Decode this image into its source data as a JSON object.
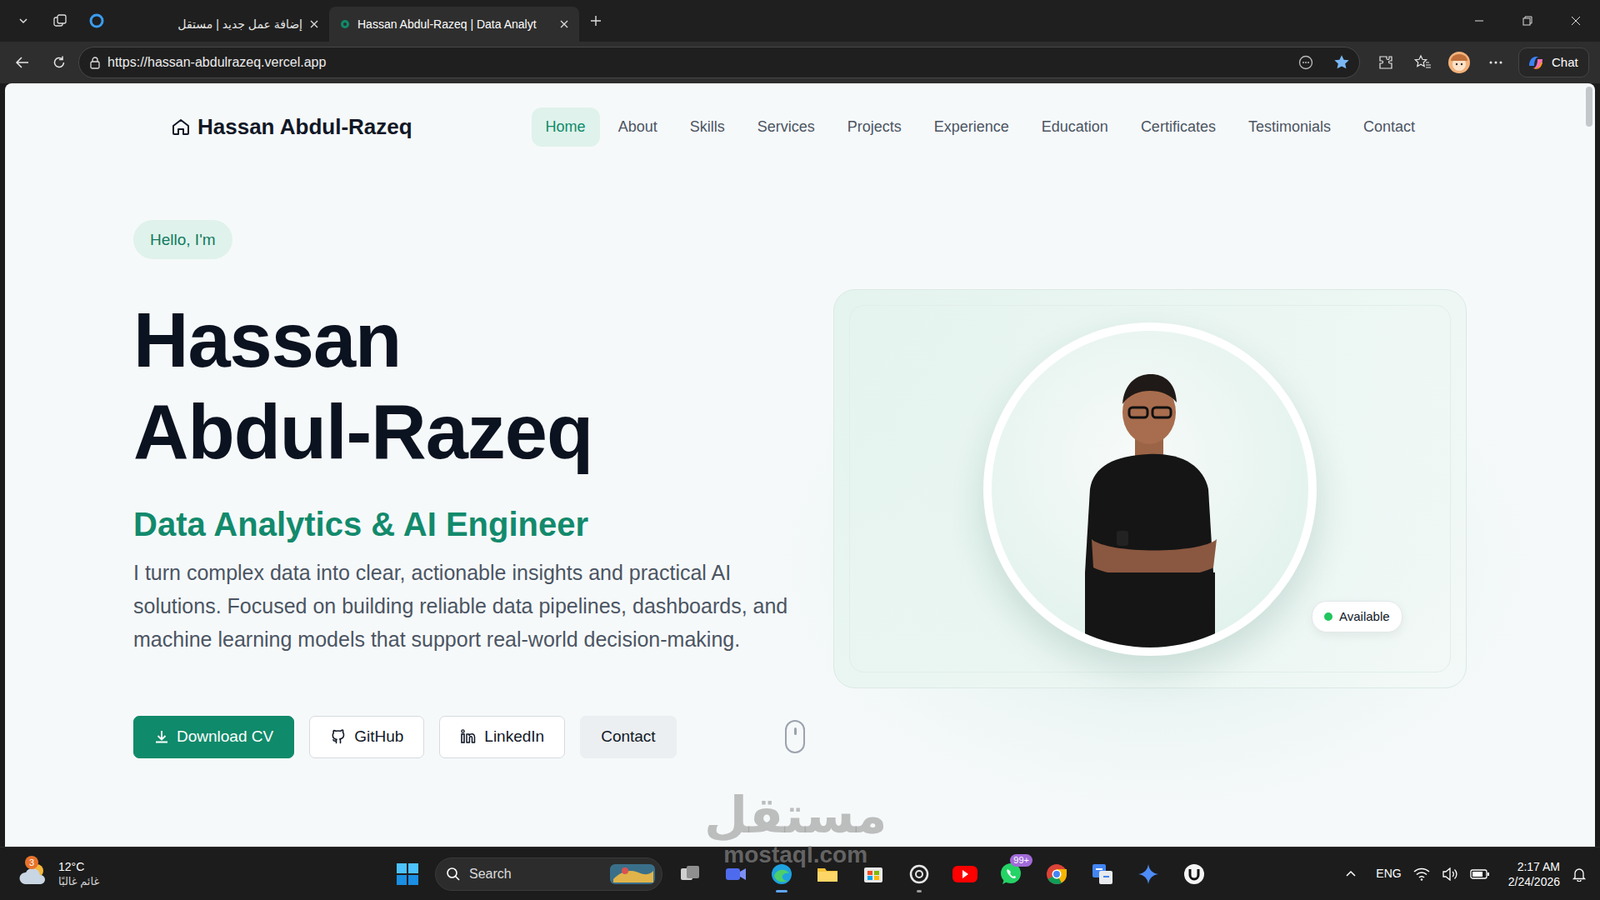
{
  "browser": {
    "tabs": [
      {
        "label": "إضافة عمل جديد | مستقل",
        "selected": false
      },
      {
        "label": "Hassan Abdul-Razeq | Data Analyt",
        "selected": true
      }
    ],
    "address": "https://hassan-abdulrazeq.vercel.app",
    "chat_button": "Chat"
  },
  "page": {
    "brand": "Hassan Abdul-Razeq",
    "nav": [
      {
        "label": "Home",
        "selected": true
      },
      {
        "label": "About",
        "selected": false
      },
      {
        "label": "Skills",
        "selected": false
      },
      {
        "label": "Services",
        "selected": false
      },
      {
        "label": "Projects",
        "selected": false
      },
      {
        "label": "Experience",
        "selected": false
      },
      {
        "label": "Education",
        "selected": false
      },
      {
        "label": "Certificates",
        "selected": false
      },
      {
        "label": "Testimonials",
        "selected": false
      },
      {
        "label": "Contact",
        "selected": false
      }
    ],
    "greeting": "Hello, I'm",
    "name_lines": [
      "Hassan",
      "Abdul-Razeq"
    ],
    "role": "Data Analytics & AI Engineer",
    "intro": "I turn complex data into clear, actionable insights and practical AI solutions. Focused on building reliable data pipelines, dashboards, and machine learning models that support real-world decision-making.",
    "buttons": [
      {
        "label": "Download CV",
        "kind": "primary"
      },
      {
        "label": "GitHub",
        "kind": "outline"
      },
      {
        "label": "LinkedIn",
        "kind": "outline"
      },
      {
        "label": "Contact",
        "kind": "soft"
      }
    ],
    "status_badge": {
      "label": "Available",
      "color": "#22c55e"
    }
  },
  "watermark": {
    "arabic": "مستقل",
    "latin": "mostaql.com"
  },
  "taskbar": {
    "weather": {
      "temp": "12°C",
      "condition": "غائم غالبًا",
      "badge": "3"
    },
    "search": {
      "placeholder": "Search"
    },
    "apps": [
      {
        "running": false
      },
      {
        "running": false
      },
      {
        "running": true
      },
      {
        "running": false
      },
      {
        "running": false
      },
      {
        "running": true
      },
      {
        "running": false
      },
      {
        "running": false,
        "badge": "99+"
      },
      {
        "running": false
      },
      {
        "running": false
      },
      {
        "running": false
      },
      {
        "running": false
      }
    ],
    "tray": {
      "language": "ENG",
      "time": "2:17 AM",
      "date": "2/24/2026"
    }
  }
}
